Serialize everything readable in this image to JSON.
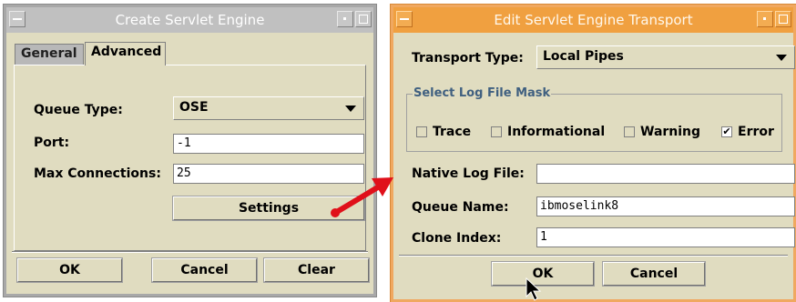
{
  "create_window": {
    "title": "Create Servlet Engine",
    "tabs": [
      {
        "label": "General"
      },
      {
        "label": "Advanced"
      }
    ],
    "queue_type": {
      "label": "Queue Type:",
      "value": "OSE"
    },
    "port": {
      "label": "Port:",
      "value": "-1"
    },
    "max_connections": {
      "label": "Max Connections:",
      "value": "25"
    },
    "settings_label": "Settings",
    "ok_label": "OK",
    "cancel_label": "Cancel",
    "clear_label": "Clear"
  },
  "transport_window": {
    "title": "Edit Servlet Engine Transport",
    "transport_type": {
      "label": "Transport Type:",
      "value": "Local Pipes"
    },
    "log_mask": {
      "title": "Select Log File Mask",
      "options": [
        {
          "label": "Trace",
          "checked": false
        },
        {
          "label": "Informational",
          "checked": false
        },
        {
          "label": "Warning",
          "checked": false
        },
        {
          "label": "Error",
          "checked": true
        }
      ]
    },
    "native_log_file": {
      "label": "Native Log File:",
      "value": ""
    },
    "queue_name": {
      "label": "Queue Name:",
      "value": "ibmoselink8"
    },
    "clone_index": {
      "label": "Clone Index:",
      "value": "1"
    },
    "ok_label": "OK",
    "cancel_label": "Cancel"
  },
  "colors": {
    "window_bg": "#e0dcc0",
    "titlebar_inactive": "#c0c0c0",
    "titlebar_active": "#f0a040",
    "arrow_red": "#e0101a"
  }
}
